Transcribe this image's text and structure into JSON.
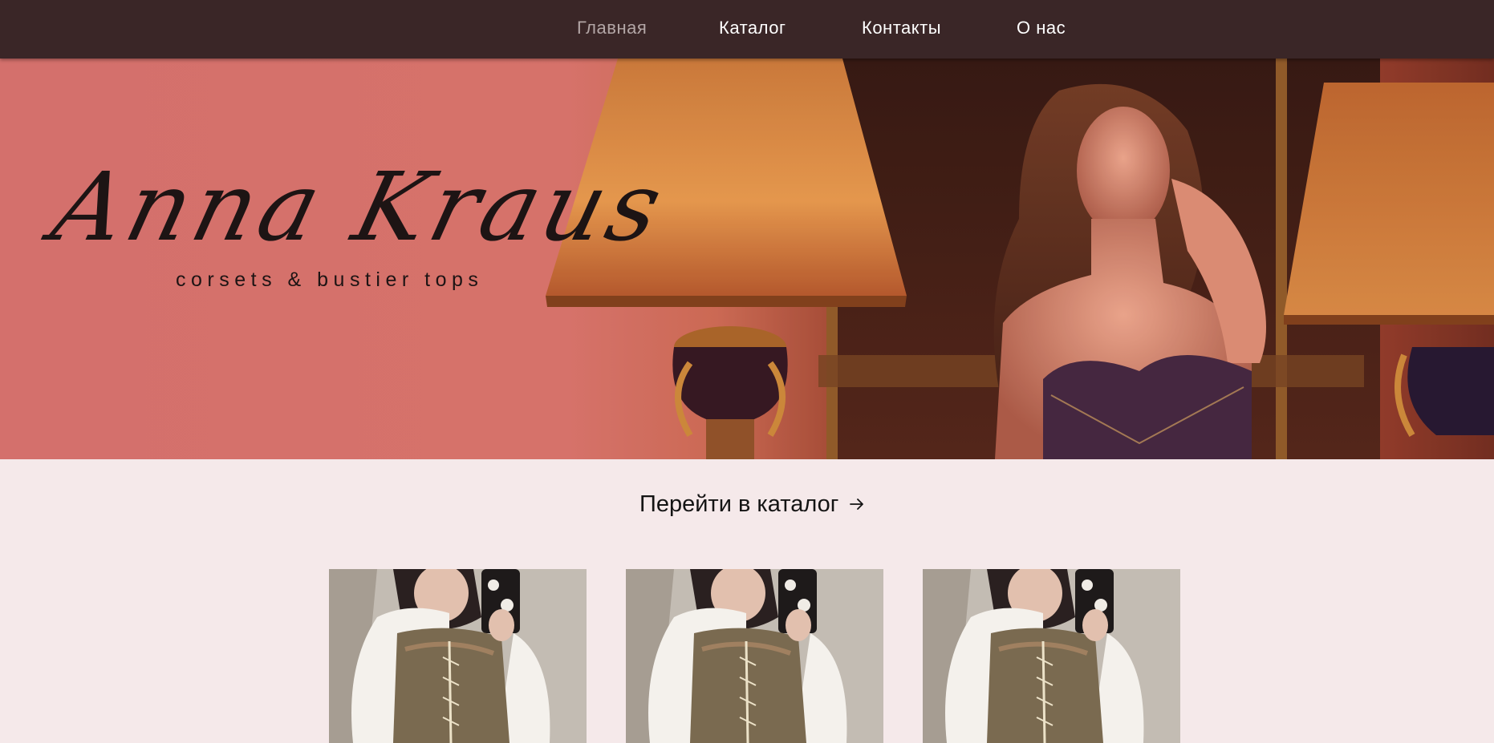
{
  "nav": {
    "items": [
      {
        "label": "Главная",
        "active": true
      },
      {
        "label": "Каталог",
        "active": false
      },
      {
        "label": "Контакты",
        "active": false
      },
      {
        "label": "О нас",
        "active": false
      }
    ]
  },
  "hero": {
    "brand_name": "Anna Kraus",
    "tagline": "corsets & bustier tops"
  },
  "catalog_link": {
    "label": "Перейти в каталог",
    "icon": "arrow-right-icon"
  },
  "products": [
    {
      "image": "corset-photo"
    },
    {
      "image": "corset-photo"
    },
    {
      "image": "corset-photo"
    }
  ],
  "colors": {
    "nav_bg": "#3a2627",
    "nav_text": "#ffffff",
    "nav_active": "#b3a6a6",
    "page_bg": "#f5e9ea",
    "hero_pink": "#d2716f",
    "text_dark": "#141414"
  }
}
